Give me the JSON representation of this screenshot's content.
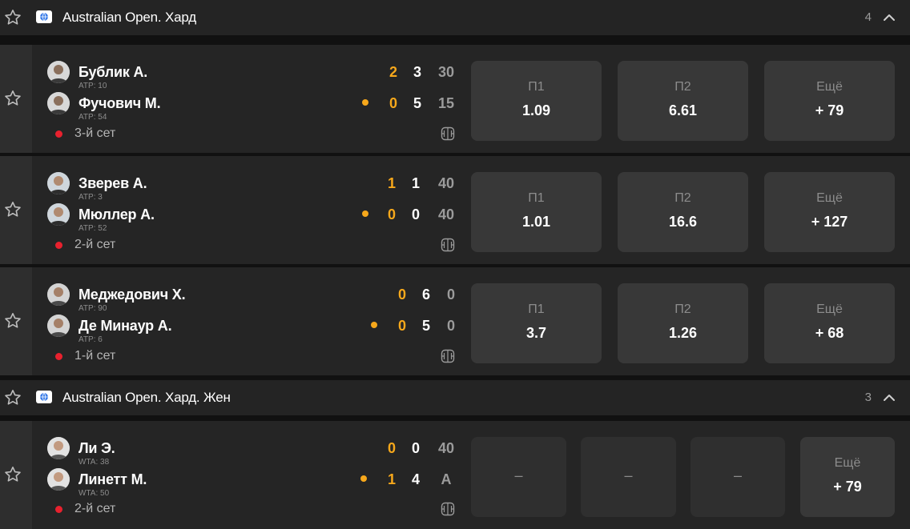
{
  "leagues": [
    {
      "name": "Australian Open. Хард",
      "count": "4"
    },
    {
      "name": "Australian Open. Хард. Жен",
      "count": "3"
    }
  ],
  "matches": [
    {
      "p1": {
        "name": "Бублик А.",
        "rank": "ATP: 10"
      },
      "p2": {
        "name": "Фучович М.",
        "rank": "ATP: 54"
      },
      "score1": {
        "set": "2",
        "game": "3",
        "pts": "30"
      },
      "score2": {
        "set": "0",
        "game": "5",
        "pts": "15"
      },
      "status": "3-й сет",
      "odds": {
        "l1": "П1",
        "v1": "1.09",
        "l2": "П2",
        "v2": "6.61",
        "lm": "Ещё",
        "vm": "+ 79"
      }
    },
    {
      "p1": {
        "name": "Зверев А.",
        "rank": "ATP: 3"
      },
      "p2": {
        "name": "Мюллер А.",
        "rank": "ATP: 52"
      },
      "score1": {
        "set": "1",
        "game": "1",
        "pts": "40"
      },
      "score2": {
        "set": "0",
        "game": "0",
        "pts": "40"
      },
      "status": "2-й сет",
      "odds": {
        "l1": "П1",
        "v1": "1.01",
        "l2": "П2",
        "v2": "16.6",
        "lm": "Ещё",
        "vm": "+ 127"
      }
    },
    {
      "p1": {
        "name": "Меджедович Х.",
        "rank": "ATP: 90"
      },
      "p2": {
        "name": "Де Минаур А.",
        "rank": "ATP: 6"
      },
      "score1": {
        "set": "0",
        "game": "6",
        "pts": "0"
      },
      "score2": {
        "set": "0",
        "game": "5",
        "pts": "0"
      },
      "status": "1-й сет",
      "odds": {
        "l1": "П1",
        "v1": "3.7",
        "l2": "П2",
        "v2": "1.26",
        "lm": "Ещё",
        "vm": "+ 68"
      }
    },
    {
      "p1": {
        "name": "Ли Э.",
        "rank": "WTA: 38"
      },
      "p2": {
        "name": "Линетт М.",
        "rank": "WTA: 50"
      },
      "score1": {
        "set": "0",
        "game": "0",
        "pts": "40"
      },
      "score2": {
        "set": "1",
        "game": "4",
        "pts": "A"
      },
      "status": "2-й сет",
      "odds": {
        "d1": "–",
        "d2": "–",
        "d3": "–",
        "lm": "Ещё",
        "vm": "+ 79"
      }
    }
  ],
  "colors": {
    "accent_orange": "#f7a81b",
    "live_red": "#e8212e",
    "background": "#111111",
    "card": "#252525",
    "odd_button": "#383838"
  },
  "icons": {
    "favorite": "star-outline-icon",
    "region": "globe-icon",
    "collapse": "chevron-up-icon",
    "scoreboard": "tennis-court-icon"
  }
}
